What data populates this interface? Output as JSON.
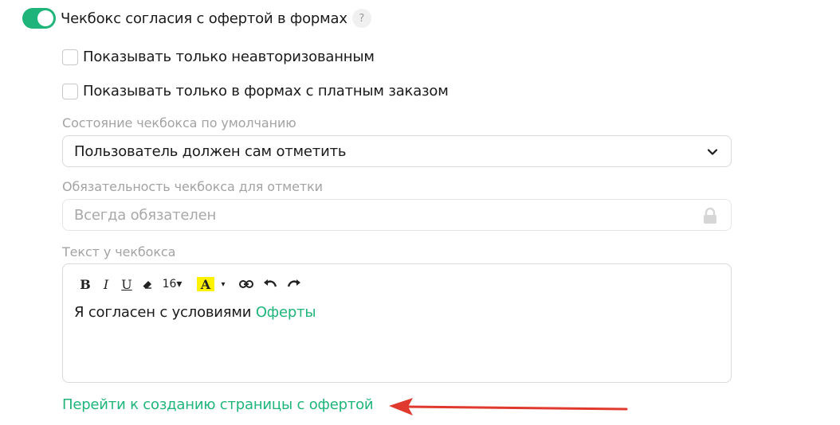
{
  "toggle": {
    "label": "Чекбокс согласия с офертой в формах",
    "help": "?",
    "enabled": true
  },
  "checkboxes": [
    {
      "label": "Показывать только неавторизованным",
      "checked": false
    },
    {
      "label": "Показывать только в формах с платным заказом",
      "checked": false
    }
  ],
  "default_state": {
    "label": "Состояние чекбокса по умолчанию",
    "value": "Пользователь должен сам отметить"
  },
  "required": {
    "label": "Обязательность чекбокса для отметки",
    "value": "Всегда обязателен"
  },
  "checkbox_text": {
    "label": "Текст у чекбокса",
    "toolbar": {
      "bold": "B",
      "italic": "I",
      "underline": "U",
      "font_size": "16▾",
      "color": "A",
      "color_caret": "▾"
    },
    "text_plain": "Я согласен с условиями ",
    "text_link": "Оферты"
  },
  "offer_link": "Перейти к созданию страницы с офертой",
  "colors": {
    "accent": "#1fb57a",
    "arrow": "#e03a2f",
    "highlight": "#fff200"
  }
}
